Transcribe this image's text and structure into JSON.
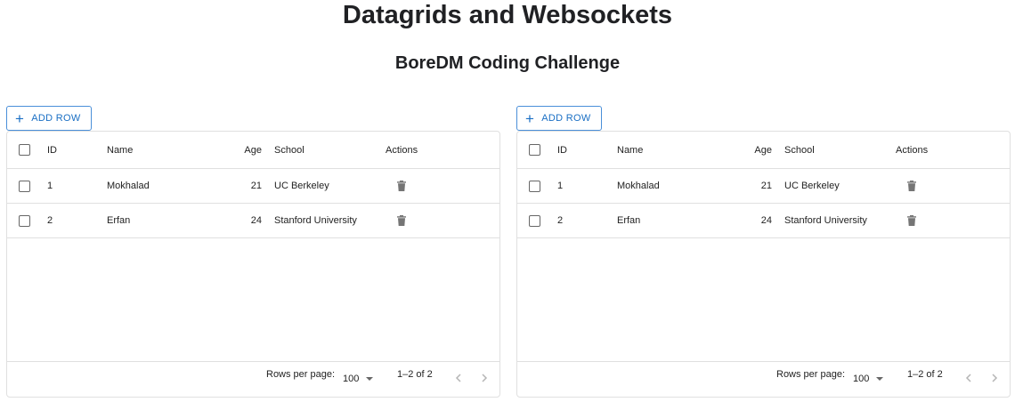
{
  "page": {
    "title": "Datagrids and Websockets",
    "subtitle": "BoreDM Coding Challenge"
  },
  "grids": [
    {
      "add_row_label": "ADD ROW",
      "columns": {
        "id": "ID",
        "name": "Name",
        "age": "Age",
        "school": "School",
        "actions": "Actions"
      },
      "rows": [
        {
          "id": "1",
          "name": "Mokhalad",
          "age": "21",
          "school": "UC Berkeley"
        },
        {
          "id": "2",
          "name": "Erfan",
          "age": "24",
          "school": "Stanford University"
        }
      ],
      "footer": {
        "rows_per_page_label": "Rows per page:",
        "rows_per_page_value": "100",
        "range_text": "1–2 of 2"
      }
    },
    {
      "add_row_label": "ADD ROW",
      "columns": {
        "id": "ID",
        "name": "Name",
        "age": "Age",
        "school": "School",
        "actions": "Actions"
      },
      "rows": [
        {
          "id": "1",
          "name": "Mokhalad",
          "age": "21",
          "school": "UC Berkeley"
        },
        {
          "id": "2",
          "name": "Erfan",
          "age": "24",
          "school": "Stanford University"
        }
      ],
      "footer": {
        "rows_per_page_label": "Rows per page:",
        "rows_per_page_value": "100",
        "range_text": "1–2 of 2"
      }
    }
  ],
  "icons": {
    "add": "plus-icon",
    "delete": "trash-icon",
    "dropdown": "caret-down-icon",
    "prev": "chevron-left-icon",
    "next": "chevron-right-icon"
  },
  "colors": {
    "accent": "#1a6fc4",
    "border": "#e0e0e0",
    "icon": "#757575"
  }
}
